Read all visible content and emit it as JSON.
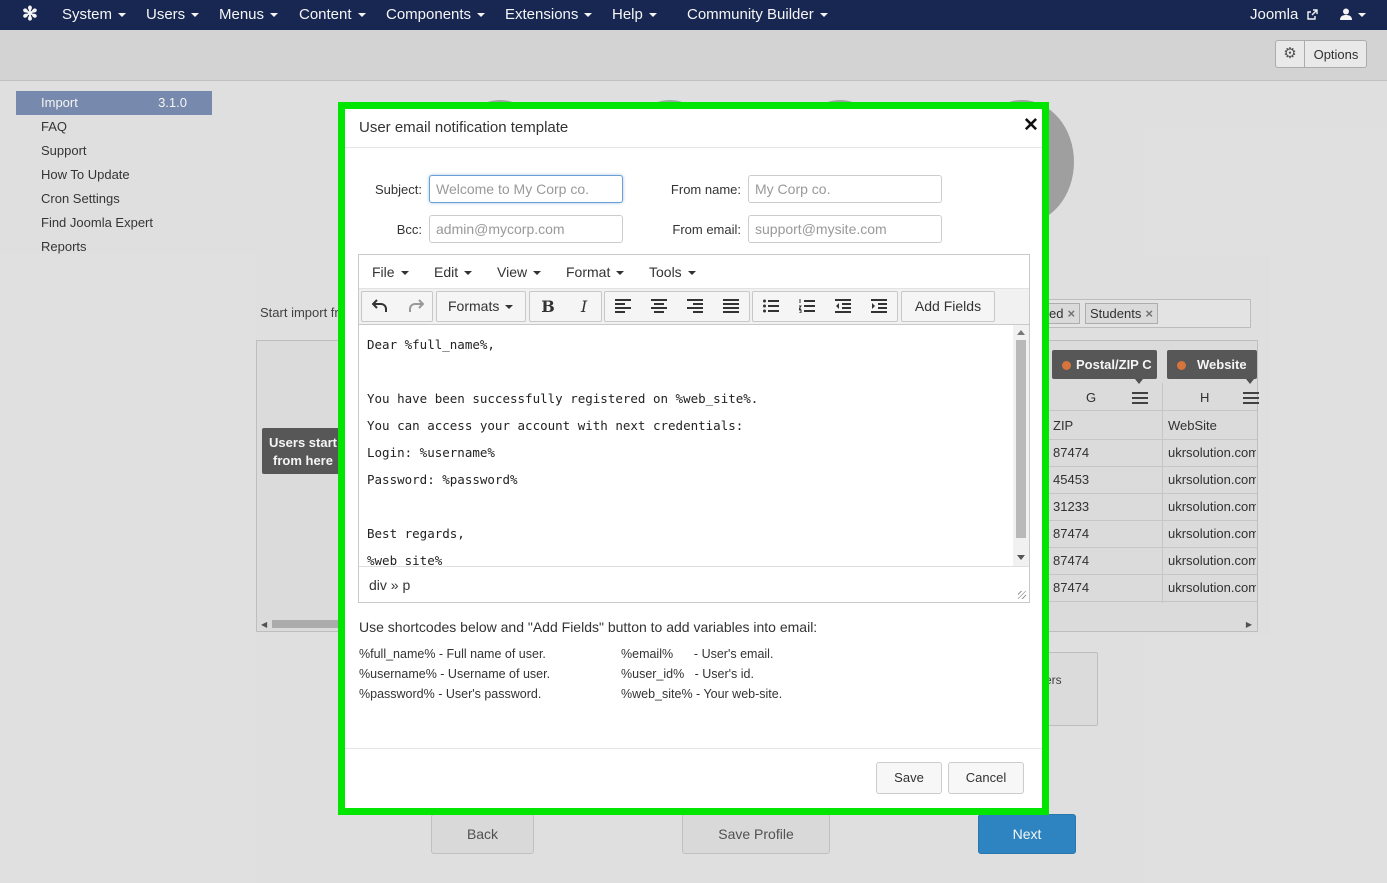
{
  "navbar": {
    "logo_icon": "joomla-logo-icon",
    "items": [
      {
        "label": "System"
      },
      {
        "label": "Users"
      },
      {
        "label": "Menus"
      },
      {
        "label": "Content"
      },
      {
        "label": "Components"
      },
      {
        "label": "Extensions"
      },
      {
        "label": "Help"
      },
      {
        "label": "Community Builder"
      }
    ],
    "site_link": "Joomla",
    "user_icon": "user-icon"
  },
  "toolbar": {
    "options_label": "Options"
  },
  "sidebar": {
    "items": [
      {
        "label": "Import",
        "version": "3.1.0"
      },
      {
        "label": "FAQ"
      },
      {
        "label": "Support"
      },
      {
        "label": "How To Update"
      },
      {
        "label": "Cron Settings"
      },
      {
        "label": "Find Joomla Expert"
      },
      {
        "label": "Reports"
      }
    ]
  },
  "background": {
    "start_import_label": "Start import fr",
    "users_start_label": [
      "Users start",
      "from here"
    ],
    "tags": [
      "ed",
      "Students"
    ],
    "columns": [
      {
        "label": "Postal/ZIP C",
        "letter": "G",
        "header": "ZIP"
      },
      {
        "label": "Website",
        "letter": "H",
        "header": "WebSite"
      }
    ],
    "rows": [
      [
        "87474",
        "ukrsolution.com"
      ],
      [
        "45453",
        "ukrsolution.com"
      ],
      [
        "31233",
        "ukrsolution.com"
      ],
      [
        "87474",
        "ukrsolution.com"
      ],
      [
        "87474",
        "ukrsolution.com"
      ],
      [
        "87474",
        "ukrsolution.com"
      ]
    ],
    "box_fragment": "ers",
    "back_button": "Back",
    "save_profile_button": "Save Profile",
    "next_button": "Next"
  },
  "modal": {
    "title": "User email notification template",
    "close_icon": "close-icon",
    "subject_label": "Subject:",
    "subject_placeholder": "Welcome to My Corp co.",
    "bcc_label": "Bcc:",
    "bcc_placeholder": "admin@mycorp.com",
    "from_name_label": "From name:",
    "from_name_placeholder": "My Corp co.",
    "from_email_label": "From email:",
    "from_email_placeholder": "support@mysite.com",
    "editor": {
      "menu": [
        "File",
        "Edit",
        "View",
        "Format",
        "Tools"
      ],
      "formats_label": "Formats",
      "add_fields_label": "Add Fields",
      "content_lines": [
        "Dear %full_name%,",
        "",
        "You have been successfully registered on %web_site%.",
        "You can access your account with next credentials:",
        "Login: %username%",
        "Password: %password%",
        "",
        "Best regards,",
        "%web_site%"
      ],
      "status_path": "div » p"
    },
    "help_title": "Use shortcodes below and \"Add Fields\" button to add variables into email:",
    "shortcodes_left": [
      "%full_name% - Full name of user.",
      "%username% - Username of user.",
      "%password% - User's password."
    ],
    "shortcodes_right": [
      "%email%      - User's email.",
      "%user_id%   - User's id.",
      "%web_site% - Your web-site."
    ],
    "save_label": "Save",
    "cancel_label": "Cancel"
  },
  "colors": {
    "navbar": "#1a2955",
    "sidebar_active": "#7c8fb4",
    "modal_highlight": "#00e600",
    "primary_button": "#2f8ac9"
  }
}
